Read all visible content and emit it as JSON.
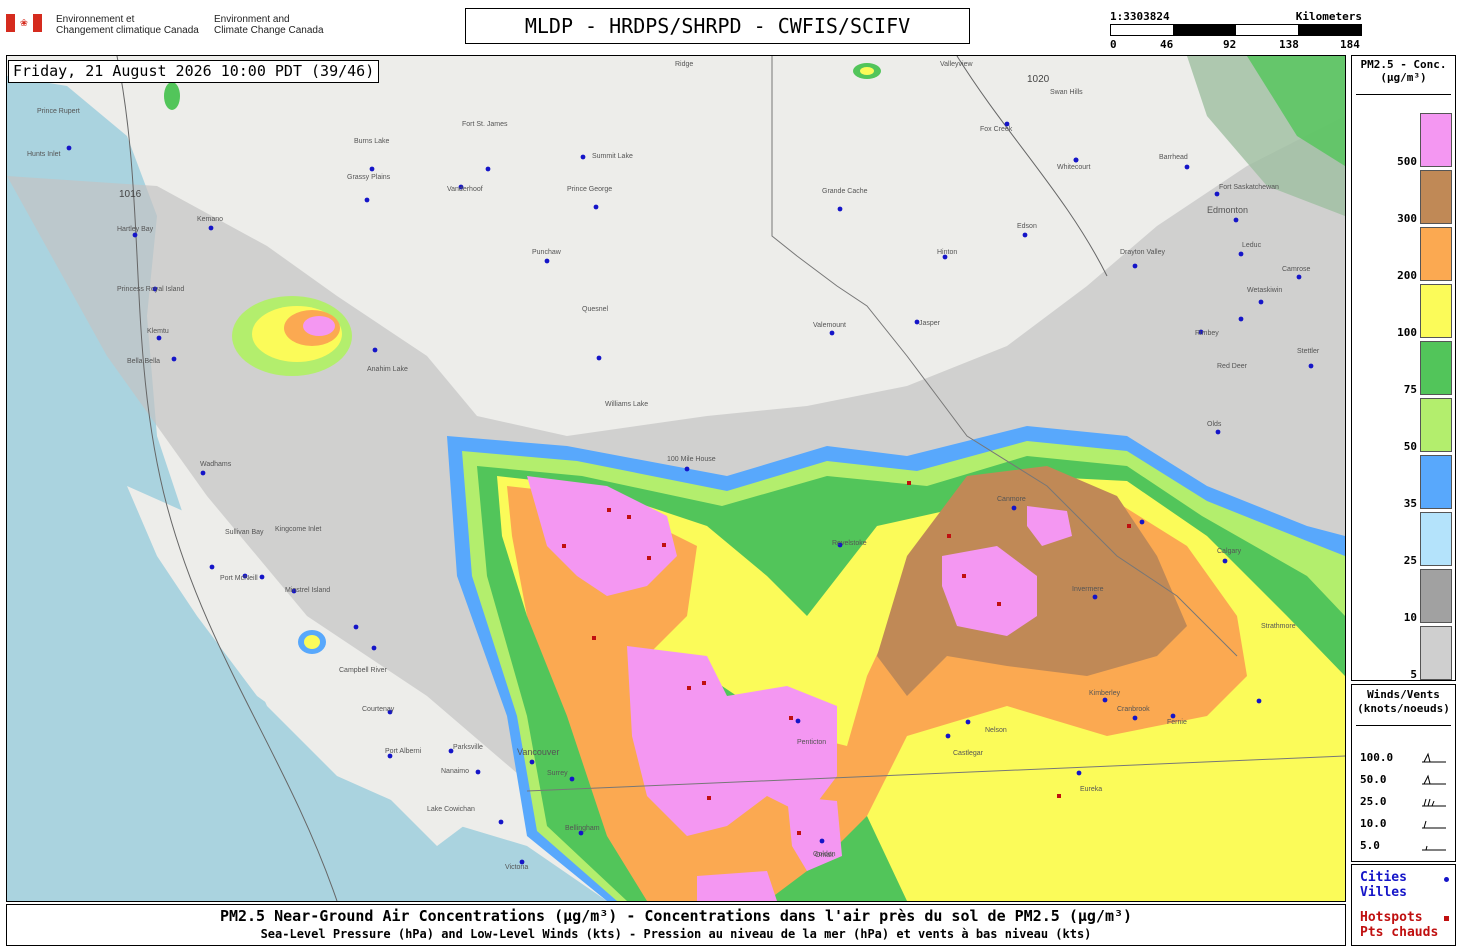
{
  "header": {
    "dept_fr": [
      "Environnement et",
      "Changement climatique Canada"
    ],
    "dept_en": [
      "Environment and",
      "Climate Change Canada"
    ],
    "title": "MLDP - HRDPS/SHRPD - CWFIS/SCIFV"
  },
  "scale": {
    "ratio": "1:3303824",
    "unit": "Kilometers",
    "ticks": [
      "0",
      "46",
      "92",
      "138",
      "184"
    ]
  },
  "map": {
    "datetime": "Friday, 21 August 2026 10:00 PDT (39/46)",
    "isobar_labels": [
      "1016",
      "1020"
    ],
    "cities": [
      "Prince Rupert",
      "Hunts Inlet",
      "Burns Lake",
      "Fort St. James",
      "Summit Lake",
      "Grassy Plains",
      "Vanderhoof",
      "Prince George",
      "Grande Cache",
      "Swan Hills",
      "Fox Creek",
      "Whitecourt",
      "Barrhead",
      "Fort Saskatchewan",
      "Edmonton",
      "Kemano",
      "Hartley Bay",
      "Princess Royal Island",
      "Klemtu",
      "Punchaw",
      "Quesnel",
      "Hinton",
      "Edson",
      "Drayton Valley",
      "Leduc",
      "Camrose",
      "Wetaskiwin",
      "Valemount",
      "Jasper",
      "Rimbey",
      "Stettler",
      "Bella Bella",
      "Anahim Lake",
      "Williams Lake",
      "Red Deer",
      "Olds",
      "100 Mile House",
      "Wadhams",
      "Sullivan Bay",
      "Kingcome Inlet",
      "Port McNeill",
      "Minstrel Island",
      "Campbell River",
      "Courtenay",
      "Port Alberni",
      "Parksville",
      "Nanaimo",
      "Lake Cowichan",
      "Victoria",
      "Vancouver",
      "Surrey",
      "Bellingham",
      "Penticton",
      "Osoyoos",
      "Kelowna",
      "Golden",
      "Canmore",
      "Calgary",
      "Invermere",
      "Kimberley",
      "Cranbrook",
      "Fernie",
      "Eureka",
      "Nelson",
      "Castlegar",
      "Revelstoke",
      "Omak",
      "Strathmore"
    ],
    "labels": [
      "Ridge",
      "Valleyview"
    ]
  },
  "legend": {
    "title": [
      "PM2.5 - Conc.",
      "(µg/m³)"
    ],
    "bins": [
      {
        "label": "500",
        "color": "#f497f2"
      },
      {
        "label": "300",
        "color": "#c08956"
      },
      {
        "label": "200",
        "color": "#fba951"
      },
      {
        "label": "100",
        "color": "#fbfb59"
      },
      {
        "label": "75",
        "color": "#52c55a"
      },
      {
        "label": "50",
        "color": "#b3ee6d"
      },
      {
        "label": "35",
        "color": "#58a8fc"
      },
      {
        "label": "25",
        "color": "#b4e3fb"
      },
      {
        "label": "10",
        "color": "#a1a1a1"
      },
      {
        "label": "5",
        "color": "#cfcfcf"
      }
    ]
  },
  "winds": {
    "title": [
      "Winds/Vents",
      "(knots/noeuds)"
    ],
    "values": [
      "100.0",
      "50.0",
      "25.0",
      "10.0",
      "5.0"
    ]
  },
  "key": {
    "cities": [
      "Cities",
      "Villes"
    ],
    "hotspots": [
      "Hotspots",
      "Pts chauds"
    ],
    "city_color": "#1515c8",
    "hotspot_color": "#c01010"
  },
  "caption": {
    "line1": "PM2.5 Near-Ground Air Concentrations (µg/m³) - Concentrations dans l'air près du sol de PM2.5 (µg/m³)",
    "line2": "Sea-Level Pressure (hPa) and Low-Level Winds (kts) - Pression au niveau de la mer (hPa) et vents à bas niveau (kts)"
  }
}
